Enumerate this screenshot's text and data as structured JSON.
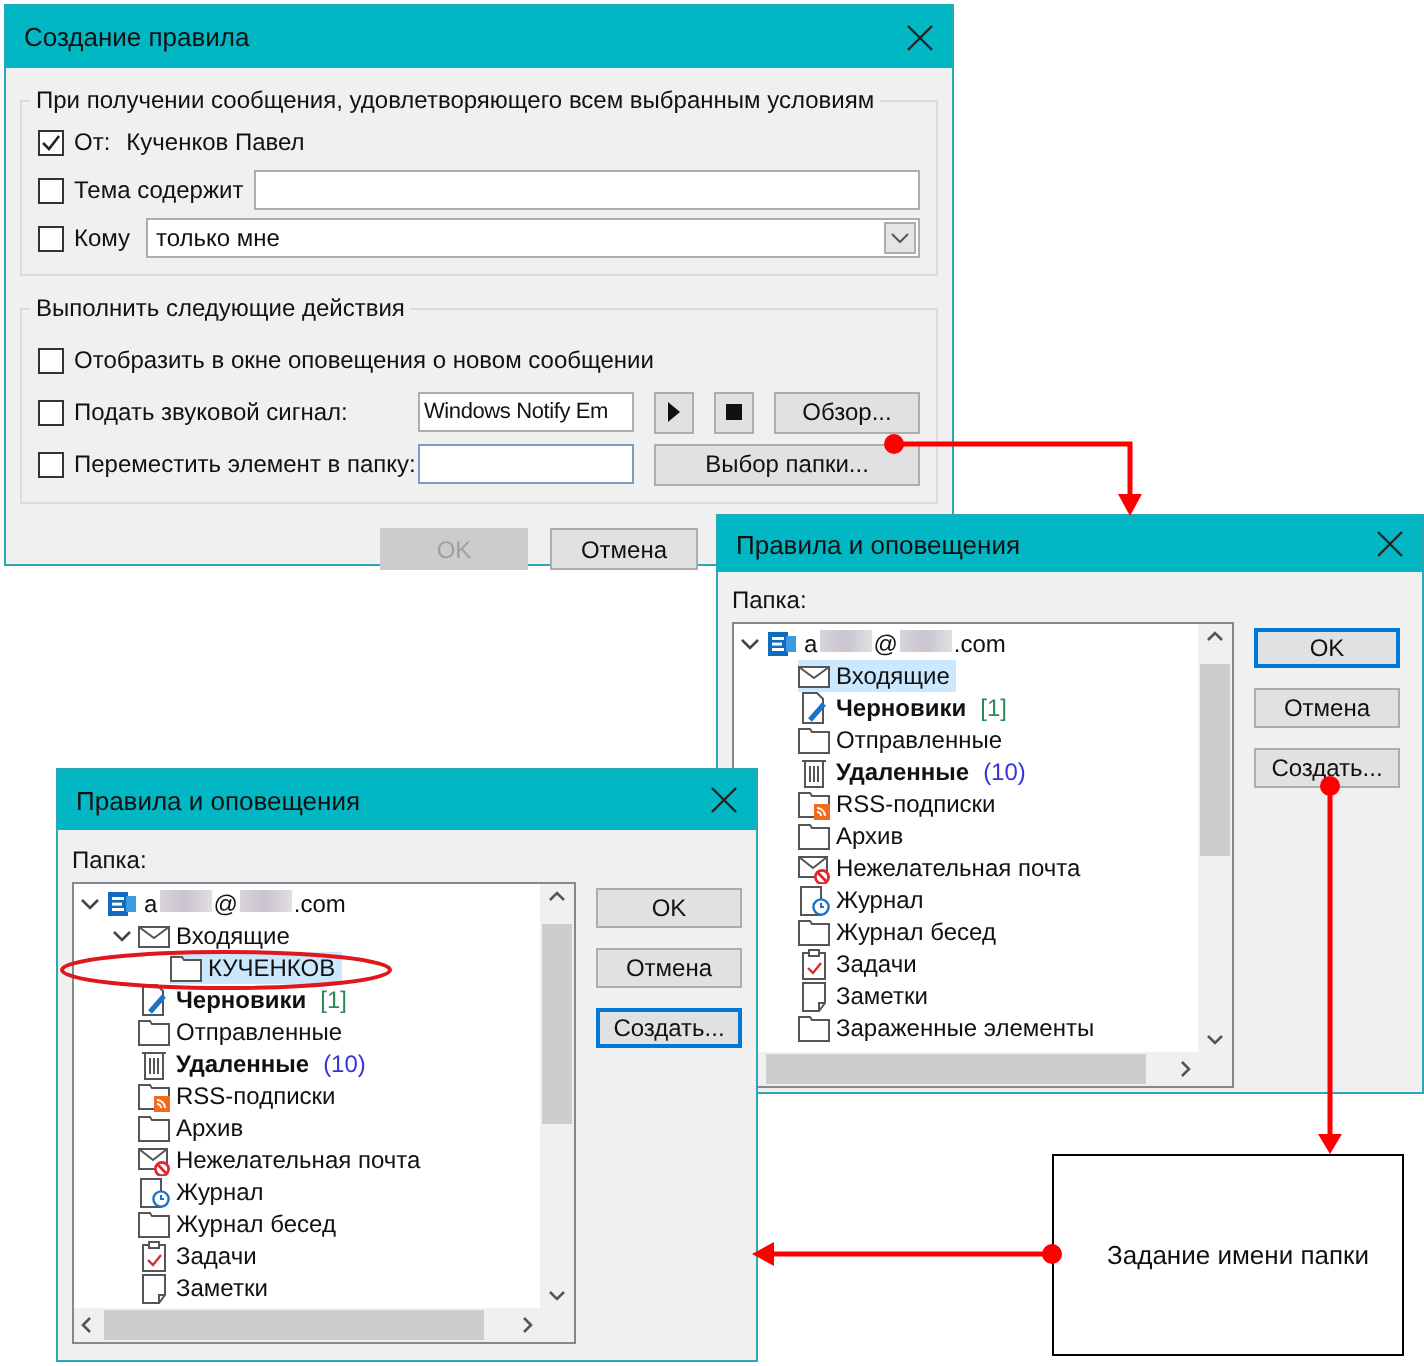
{
  "rule_dialog": {
    "title": "Создание правила",
    "conditions": {
      "legend": "При получении сообщения, удовлетворяющего всем выбранным условиям",
      "rows": [
        {
          "kind": "from",
          "checked": true,
          "label": "От:",
          "value": "Кученков Павел"
        },
        {
          "kind": "text",
          "checked": false,
          "label": "Тема содержит"
        },
        {
          "kind": "select",
          "checked": false,
          "label": "Кому",
          "value": "только мне"
        }
      ]
    },
    "actions": {
      "legend": "Выполнить следующие действия",
      "rows": [
        {
          "kind": "plain",
          "checked": false,
          "label": "Отобразить в окне оповещения о новом сообщении"
        },
        {
          "kind": "sound",
          "checked": false,
          "label": "Подать звуковой сигнал:",
          "value": "Windows Notify Em",
          "button": "Обзор..."
        },
        {
          "kind": "folder",
          "checked": false,
          "label": "Переместить элемент в папку:",
          "button": "Выбор папки..."
        }
      ]
    },
    "buttons": [
      {
        "label": "OK",
        "disabled": true
      },
      {
        "label": "Отмена",
        "disabled": false
      }
    ]
  },
  "folder_dialogs": [
    {
      "title": "Правила и оповещения",
      "folder_label": "Папка:",
      "tree": [
        {
          "kind": "account",
          "parts": [
            "a",
            "@",
            ".com"
          ],
          "selected": false,
          "expanded": true,
          "children": [
            {
              "kind": "inbox",
              "label": "Входящие",
              "selected": true
            },
            {
              "kind": "drafts",
              "label": "Черновики",
              "count": "[1]",
              "selected": false
            },
            {
              "kind": "folder",
              "label": "Отправленные",
              "selected": false
            },
            {
              "kind": "trash",
              "label": "Удаленные",
              "count": "(10)",
              "selected": false
            },
            {
              "kind": "rss",
              "label": "RSS-подписки",
              "selected": false
            },
            {
              "kind": "folder",
              "label": "Архив",
              "selected": false
            },
            {
              "kind": "junk",
              "label": "Нежелательная почта",
              "selected": false
            },
            {
              "kind": "journal",
              "label": "Журнал",
              "selected": false
            },
            {
              "kind": "folder",
              "label": "Журнал бесед",
              "selected": false
            },
            {
              "kind": "tasks",
              "label": "Задачи",
              "selected": false
            },
            {
              "kind": "notes",
              "label": "Заметки",
              "selected": false
            },
            {
              "kind": "folder",
              "label": "Зараженные элементы",
              "selected": false
            }
          ]
        }
      ],
      "buttons": [
        {
          "label": "OK",
          "focused": true
        },
        {
          "label": "Отмена",
          "focused": false
        },
        {
          "label": "Создать...",
          "focused": false
        }
      ]
    },
    {
      "title": "Правила и оповещения",
      "folder_label": "Папка:",
      "tree": [
        {
          "kind": "account",
          "parts": [
            "a",
            "@",
            ".com"
          ],
          "selected": false,
          "expanded": true,
          "children": [
            {
              "kind": "inbox",
              "label": "Входящие",
              "selected": false,
              "expanded": true,
              "children": [
                {
                  "kind": "folder",
                  "label": "КУЧЕНКОВ",
                  "selected": true
                }
              ]
            },
            {
              "kind": "drafts",
              "label": "Черновики",
              "count": "[1]",
              "selected": false
            },
            {
              "kind": "folder",
              "label": "Отправленные",
              "selected": false
            },
            {
              "kind": "trash",
              "label": "Удаленные",
              "count": "(10)",
              "selected": false
            },
            {
              "kind": "rss",
              "label": "RSS-подписки",
              "selected": false
            },
            {
              "kind": "folder",
              "label": "Архив",
              "selected": false
            },
            {
              "kind": "junk",
              "label": "Нежелательная почта",
              "selected": false
            },
            {
              "kind": "journal",
              "label": "Журнал",
              "selected": false
            },
            {
              "kind": "folder",
              "label": "Журнал бесед",
              "selected": false
            },
            {
              "kind": "tasks",
              "label": "Задачи",
              "selected": false
            },
            {
              "kind": "notes",
              "label": "Заметки",
              "selected": false
            }
          ]
        }
      ],
      "buttons": [
        {
          "label": "OK",
          "focused": false
        },
        {
          "label": "Отмена",
          "focused": false
        },
        {
          "label": "Создать...",
          "focused": true
        }
      ]
    }
  ],
  "note": {
    "text": "Задание имени папки"
  }
}
